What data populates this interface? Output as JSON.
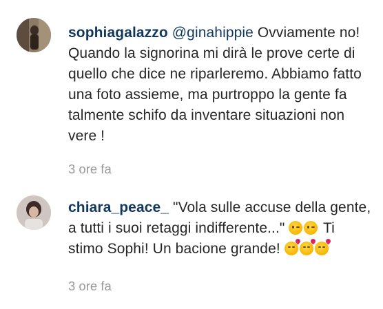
{
  "comments": [
    {
      "username": "sophiagalazzo",
      "mention": "@ginahippie",
      "text": "Ovviamente no! Quando la signorina mi dirà le prove certe di quello che dice ne riparleremo. Abbiamo fatto una foto assieme, ma purtroppo la gente fa talmente schifo da inventare situazioni non vere !",
      "time": "3 ore fa",
      "avatar": "avatar-photo"
    },
    {
      "username": "chiara_peace_",
      "text_part1": "\"Vola sulle accuse della gente, a tutti i suoi retaggi indifferente...\"",
      "text_part2": "Ti stimo Sophi! Un bacione grande!",
      "emojis_1": [
        "wink-emoji",
        "wink-emoji"
      ],
      "emojis_2": [
        "kissing-heart-emoji",
        "kissing-heart-emoji",
        "kissing-heart-emoji"
      ],
      "time": "3 ore fa",
      "avatar": "avatar-photo"
    }
  ]
}
